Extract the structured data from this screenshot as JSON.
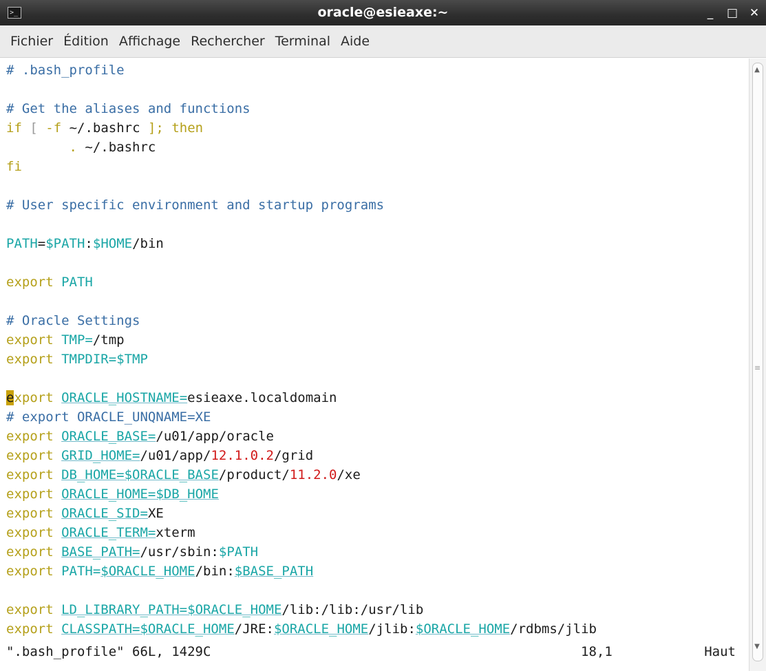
{
  "window": {
    "title": "oracle@esieaxe:~",
    "icon": "terminal-icon",
    "controls": {
      "minimize": "_",
      "maximize": "□",
      "close": "✕"
    }
  },
  "menubar": {
    "items": [
      "Fichier",
      "Édition",
      "Affichage",
      "Rechercher",
      "Terminal",
      "Aide"
    ]
  },
  "colors": {
    "comment": "#3a6ea5",
    "keyword": "#b5a01a",
    "variable": "#1aa6a6",
    "number": "#d11a1a",
    "cursor": "#c9a20a"
  },
  "editor": {
    "lines": [
      [
        [
          "c",
          "# .bash_profile"
        ]
      ],
      [],
      [
        [
          "c",
          "# Get the aliases and functions"
        ]
      ],
      [
        [
          "k",
          "if"
        ],
        [
          "t",
          " "
        ],
        [
          "p",
          "["
        ],
        [
          "t",
          " "
        ],
        [
          "k",
          "-f"
        ],
        [
          "t",
          " ~/.bashrc "
        ],
        [
          "k",
          "];"
        ],
        [
          "t",
          " "
        ],
        [
          "k",
          "then"
        ]
      ],
      [
        [
          "t",
          "        "
        ],
        [
          "k",
          "."
        ],
        [
          "t",
          " ~/.bashrc"
        ]
      ],
      [
        [
          "k",
          "fi"
        ]
      ],
      [],
      [
        [
          "c",
          "# User specific environment and startup programs"
        ]
      ],
      [],
      [
        [
          "v",
          "PATH"
        ],
        [
          "t",
          "="
        ],
        [
          "v",
          "$PATH"
        ],
        [
          "t",
          ":"
        ],
        [
          "v",
          "$HOME"
        ],
        [
          "t",
          "/bin"
        ]
      ],
      [],
      [
        [
          "k",
          "export"
        ],
        [
          "t",
          " "
        ],
        [
          "v",
          "PATH"
        ]
      ],
      [],
      [
        [
          "c",
          "# Oracle Settings"
        ]
      ],
      [
        [
          "k",
          "export"
        ],
        [
          "t",
          " "
        ],
        [
          "v",
          "TMP="
        ],
        [
          "t",
          "/tmp"
        ]
      ],
      [
        [
          "k",
          "export"
        ],
        [
          "t",
          " "
        ],
        [
          "v",
          "TMPDIR="
        ],
        [
          "v",
          "$TMP"
        ]
      ],
      [],
      [
        [
          "cur",
          "e"
        ],
        [
          "k",
          "xport"
        ],
        [
          "t",
          " "
        ],
        [
          "vu",
          "ORACLE_HOSTNAME="
        ],
        [
          "t",
          "esieaxe.localdomain"
        ]
      ],
      [
        [
          "c",
          "# export ORACLE_UNQNAME=XE"
        ]
      ],
      [
        [
          "k",
          "export"
        ],
        [
          "t",
          " "
        ],
        [
          "vu",
          "ORACLE_BASE="
        ],
        [
          "t",
          "/u01/app/oracle"
        ]
      ],
      [
        [
          "k",
          "export"
        ],
        [
          "t",
          " "
        ],
        [
          "vu",
          "GRID_HOME="
        ],
        [
          "t",
          "/u01/app/"
        ],
        [
          "n",
          "12.1.0.2"
        ],
        [
          "t",
          "/grid"
        ]
      ],
      [
        [
          "k",
          "export"
        ],
        [
          "t",
          " "
        ],
        [
          "vu",
          "DB_HOME="
        ],
        [
          "vu",
          "$ORACLE_BASE"
        ],
        [
          "t",
          "/product/"
        ],
        [
          "n",
          "11.2.0"
        ],
        [
          "t",
          "/xe"
        ]
      ],
      [
        [
          "k",
          "export"
        ],
        [
          "t",
          " "
        ],
        [
          "vu",
          "ORACLE_HOME="
        ],
        [
          "vu",
          "$DB_HOME"
        ]
      ],
      [
        [
          "k",
          "export"
        ],
        [
          "t",
          " "
        ],
        [
          "vu",
          "ORACLE_SID="
        ],
        [
          "t",
          "XE"
        ]
      ],
      [
        [
          "k",
          "export"
        ],
        [
          "t",
          " "
        ],
        [
          "vu",
          "ORACLE_TERM="
        ],
        [
          "t",
          "xterm"
        ]
      ],
      [
        [
          "k",
          "export"
        ],
        [
          "t",
          " "
        ],
        [
          "vu",
          "BASE_PATH="
        ],
        [
          "t",
          "/usr/sbin:"
        ],
        [
          "v",
          "$PATH"
        ]
      ],
      [
        [
          "k",
          "export"
        ],
        [
          "t",
          " "
        ],
        [
          "v",
          "PATH="
        ],
        [
          "vu",
          "$ORACLE_HOME"
        ],
        [
          "t",
          "/bin:"
        ],
        [
          "vu",
          "$BASE_PATH"
        ]
      ],
      [],
      [
        [
          "k",
          "export"
        ],
        [
          "t",
          " "
        ],
        [
          "vu",
          "LD_LIBRARY_PATH="
        ],
        [
          "vu",
          "$ORACLE_HOME"
        ],
        [
          "t",
          "/lib:/lib:/usr/lib"
        ]
      ],
      [
        [
          "k",
          "export"
        ],
        [
          "t",
          " "
        ],
        [
          "vu",
          "CLASSPATH="
        ],
        [
          "vu",
          "$ORACLE_HOME"
        ],
        [
          "t",
          "/JRE:"
        ],
        [
          "vu",
          "$ORACLE_HOME"
        ],
        [
          "t",
          "/jlib:"
        ],
        [
          "vu",
          "$ORACLE_HOME"
        ],
        [
          "t",
          "/rdbms/jlib"
        ]
      ]
    ]
  },
  "status": {
    "file": "\".bash_profile\" 66L, 1429C",
    "position": "18,1",
    "scroll": "Haut"
  }
}
